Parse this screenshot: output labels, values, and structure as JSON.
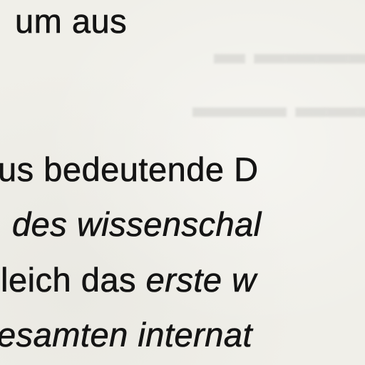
{
  "lines": [
    {
      "segments": [
        {
          "text": "um aus",
          "italic": false
        }
      ]
    },
    {
      "segments": [
        {
          "text": "us bedeutende D",
          "italic": false
        }
      ]
    },
    {
      "segments": [
        {
          "text": "des wissenschal",
          "italic": true
        }
      ]
    },
    {
      "segments": [
        {
          "text": "leich das ",
          "italic": false
        },
        {
          "text": "erste w",
          "italic": true
        }
      ]
    },
    {
      "segments": [
        {
          "text": "esamten internat",
          "italic": true
        }
      ]
    }
  ]
}
